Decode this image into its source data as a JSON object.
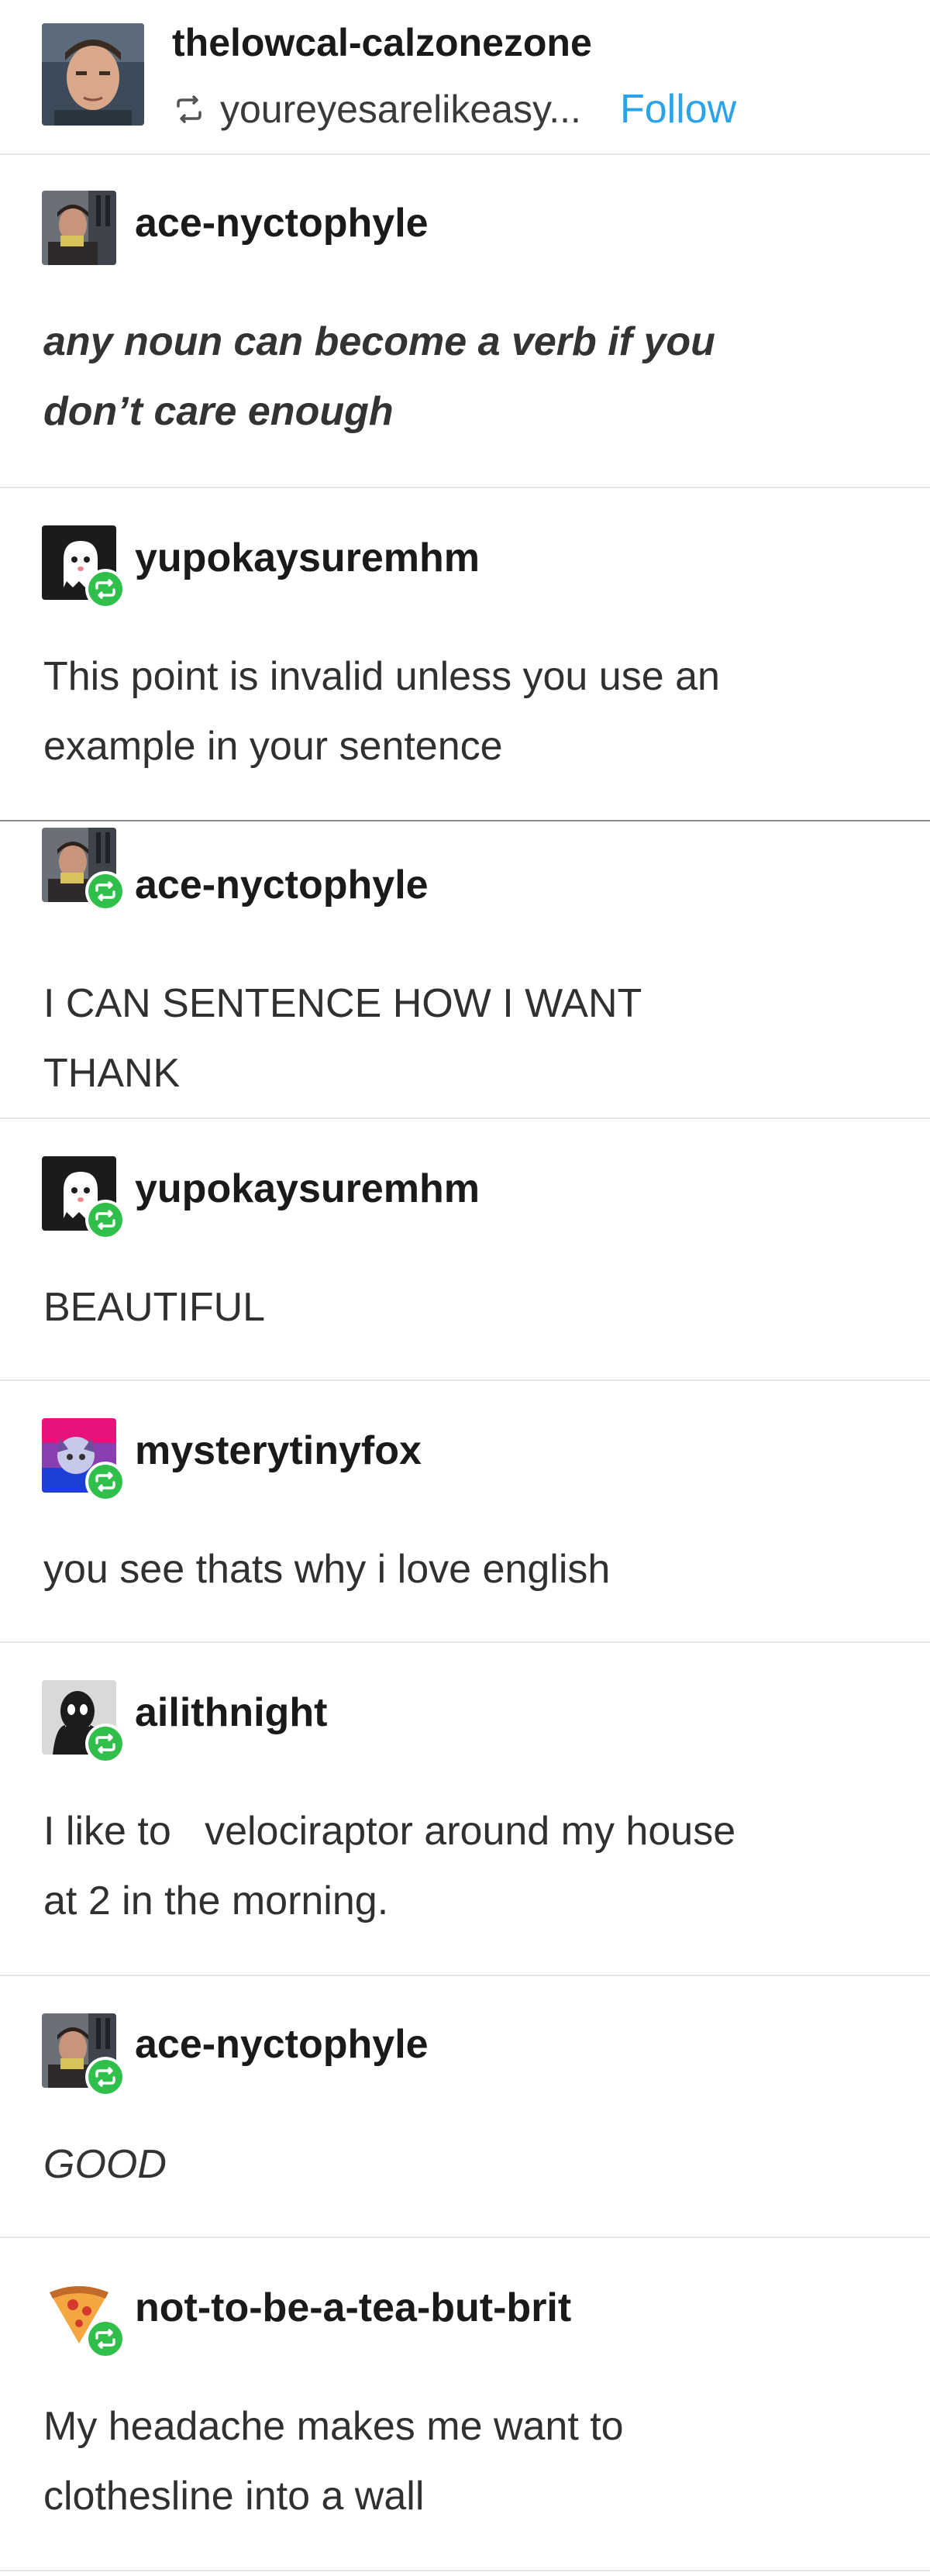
{
  "header": {
    "username": "thelowcal-calzonezone",
    "reblog_source": "youreyesarelikeasy...",
    "follow_label": "Follow",
    "avatar_icon": "man-portrait-avatar",
    "reblog_icon": "reblog-icon"
  },
  "colors": {
    "follow": "#2aa3e8",
    "reblog_badge": "#2fbf4a",
    "divider": "#e6e6e6"
  },
  "posts": [
    {
      "username": "ace-nyctophyle",
      "avatar_icon": "portrait-avatar",
      "text": "any noun can become a verb if you\ndon’t care enough"
    },
    {
      "username": "yupokaysuremhm",
      "avatar_icon": "ghost-avatar",
      "text": "This point is invalid unless you use an\nexample in your sentence"
    },
    {
      "username": "ace-nyctophyle",
      "avatar_icon": "portrait-avatar",
      "text": "I CAN SENTENCE HOW I WANT\nTHANK"
    },
    {
      "username": "yupokaysuremhm",
      "avatar_icon": "ghost-avatar",
      "text": "BEAUTIFUL"
    },
    {
      "username": "mysterytinyfox",
      "avatar_icon": "fox-avatar",
      "text": "you see thats why i love english"
    },
    {
      "username": "ailithnight",
      "avatar_icon": "dark-figure-avatar",
      "text": "I like to   velociraptor around my house\nat 2 in the morning."
    },
    {
      "username": "ace-nyctophyle",
      "avatar_icon": "portrait-avatar",
      "text": "GOOD"
    },
    {
      "username": "not-to-be-a-tea-but-brit",
      "avatar_icon": "pizza-avatar",
      "text": "My headache makes me want to\nclothesline into a wall"
    }
  ]
}
